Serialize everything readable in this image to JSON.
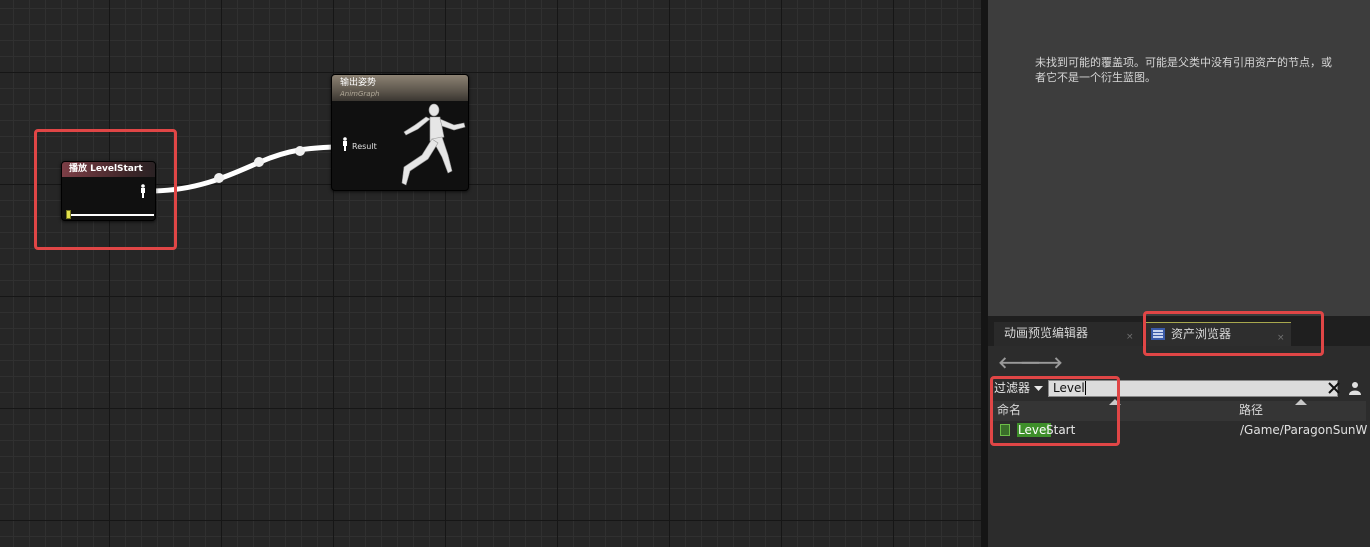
{
  "graph": {
    "play_node": {
      "title": "播放 LevelStart"
    },
    "output_node": {
      "title": "输出姿势",
      "subtitle": "AnimGraph",
      "result_label": "Result"
    }
  },
  "details": {
    "message": "未找到可能的覆盖项。可能是父类中没有引用资产的节点，或者它不是一个衍生蓝图。"
  },
  "tabs": [
    {
      "label": "动画预览编辑器",
      "close": "×"
    },
    {
      "label": "资产浏览器",
      "close": "×"
    }
  ],
  "nav": {
    "back": "🡐",
    "forward": "🡒"
  },
  "asset_browser": {
    "filter_label": "过滤器",
    "search_value": "Level",
    "columns": {
      "name": "命名",
      "path": "路径"
    },
    "rows": [
      {
        "name_match": "Level",
        "name_rest": "Start",
        "path": "/Game/ParagonSunW"
      }
    ]
  },
  "colors": {
    "highlight": "#e04646",
    "match": "#3e8f2a",
    "wire": "#ffffff"
  },
  "icons": [
    "pose-pin-icon",
    "runner-icon",
    "asset-browser-icon",
    "dropdown-icon",
    "close-icon",
    "person-icon",
    "animation-sequence-icon",
    "sort-ascending-icon"
  ]
}
